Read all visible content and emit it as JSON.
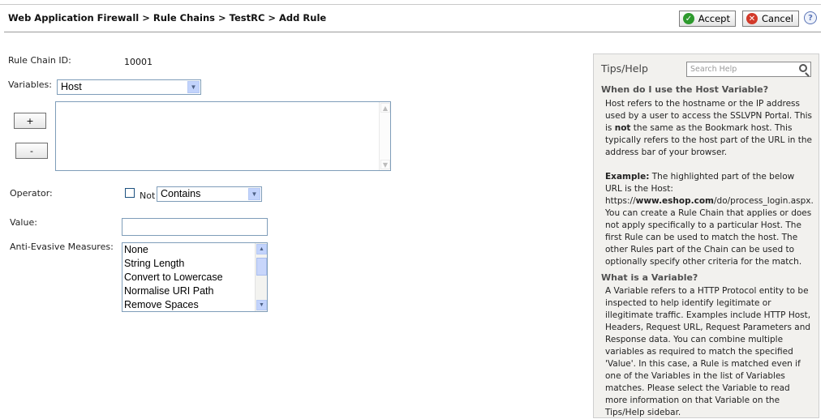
{
  "header": {
    "breadcrumb": "Web Application Firewall > Rule Chains > TestRC > Add Rule",
    "accept_label": "Accept",
    "cancel_label": "Cancel",
    "help_label": "?"
  },
  "form": {
    "rule_chain_id_label": "Rule Chain ID:",
    "rule_chain_id_value": "10001",
    "variables_label": "Variables:",
    "variables_selected": "Host",
    "add_label": "+",
    "remove_label": "-",
    "operator_label": "Operator:",
    "not_label": "Not",
    "operator_selected": "Contains",
    "value_label": "Value:",
    "value_text": "",
    "anti_evasive_label": "Anti-Evasive Measures:",
    "anti_evasive_options": [
      "None",
      "String Length",
      "Convert to Lowercase",
      "Normalise URI Path",
      "Remove Spaces"
    ]
  },
  "tips": {
    "title": "Tips/Help",
    "search_placeholder": "Search Help",
    "q1": "When do I use the Host Variable?",
    "a1_pre": "Host refers to the hostname or the IP address used by a user to access the SSLVPN Portal. This is ",
    "a1_bold": "not",
    "a1_post": " the same as the Bookmark host. This typically refers to the host part of the URL in the address bar of your browser.",
    "ex_label": "Example:",
    "ex_text": " The highlighted part of the below URL is the Host:",
    "ex_url_pre": "https://",
    "ex_url_bold": "www.eshop.com",
    "ex_url_post": "/do/process_login.aspx.",
    "ex_more": "You can create a Rule Chain that applies or does not apply specifically to a particular Host. The first Rule can be used to match the host. The other Rules part of the Chain can be used to optionally specify other criteria for the match.",
    "q2": "What is a Variable?",
    "a2": "A Variable refers to a HTTP Protocol entity to be inspected to help identify legitimate or illegitimate traffic. Examples include HTTP Host, Headers, Request URL, Request Parameters and Response data. You can combine multiple variables as required to match the specified 'Value'. In this case, a Rule is matched even if one of the Variables in the list of Variables matches. Please select the Variable to read more information on that Variable on the Tips/Help sidebar."
  },
  "colors": {
    "accept_icon": "#2e9a2e",
    "cancel_icon": "#d23a2a",
    "select_arrow": "#c2d3fc",
    "tips_bg": "#f2f1ee"
  }
}
